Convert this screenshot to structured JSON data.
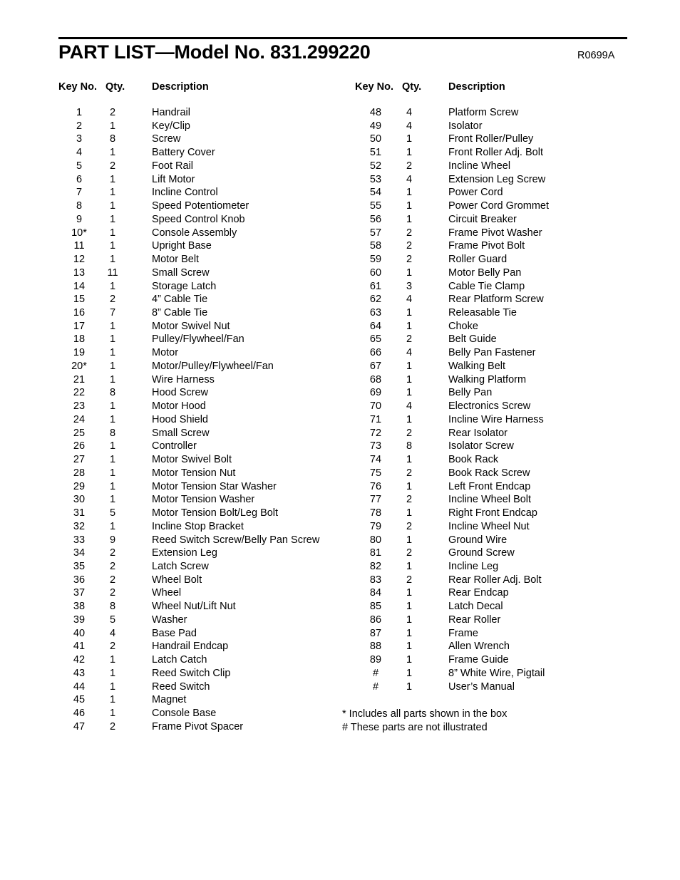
{
  "header": {
    "title": "PART LIST—Model No. 831.299220",
    "revision": "R0699A"
  },
  "columns": {
    "key_label": "Key No.",
    "qty_label": "Qty.",
    "description_label": "Description"
  },
  "footnotes": [
    "* Includes all parts shown in the box",
    "# These parts are not illustrated"
  ],
  "parts_left": [
    {
      "key": "1",
      "qty": "2",
      "description": "Handrail"
    },
    {
      "key": "2",
      "qty": "1",
      "description": "Key/Clip"
    },
    {
      "key": "3",
      "qty": "8",
      "description": "Screw"
    },
    {
      "key": "4",
      "qty": "1",
      "description": "Battery Cover"
    },
    {
      "key": "5",
      "qty": "2",
      "description": "Foot Rail"
    },
    {
      "key": "6",
      "qty": "1",
      "description": "Lift Motor"
    },
    {
      "key": "7",
      "qty": "1",
      "description": "Incline Control"
    },
    {
      "key": "8",
      "qty": "1",
      "description": "Speed Potentiometer"
    },
    {
      "key": "9",
      "qty": "1",
      "description": "Speed Control Knob"
    },
    {
      "key": "10*",
      "qty": "1",
      "description": "Console Assembly"
    },
    {
      "key": "11",
      "qty": "1",
      "description": "Upright Base"
    },
    {
      "key": "12",
      "qty": "1",
      "description": "Motor Belt"
    },
    {
      "key": "13",
      "qty": "11",
      "description": "Small Screw"
    },
    {
      "key": "14",
      "qty": "1",
      "description": "Storage Latch"
    },
    {
      "key": "15",
      "qty": "2",
      "description": "4” Cable Tie"
    },
    {
      "key": "16",
      "qty": "7",
      "description": "8” Cable Tie"
    },
    {
      "key": "17",
      "qty": "1",
      "description": "Motor Swivel Nut"
    },
    {
      "key": "18",
      "qty": "1",
      "description": "Pulley/Flywheel/Fan"
    },
    {
      "key": "19",
      "qty": "1",
      "description": "Motor"
    },
    {
      "key": "20*",
      "qty": "1",
      "description": "Motor/Pulley/Flywheel/Fan"
    },
    {
      "key": "21",
      "qty": "1",
      "description": "Wire Harness"
    },
    {
      "key": "22",
      "qty": "8",
      "description": "Hood Screw"
    },
    {
      "key": "23",
      "qty": "1",
      "description": "Motor Hood"
    },
    {
      "key": "24",
      "qty": "1",
      "description": "Hood Shield"
    },
    {
      "key": "25",
      "qty": "8",
      "description": "Small Screw"
    },
    {
      "key": "26",
      "qty": "1",
      "description": "Controller"
    },
    {
      "key": "27",
      "qty": "1",
      "description": "Motor Swivel Bolt"
    },
    {
      "key": "28",
      "qty": "1",
      "description": "Motor Tension Nut"
    },
    {
      "key": "29",
      "qty": "1",
      "description": "Motor Tension Star Washer"
    },
    {
      "key": "30",
      "qty": "1",
      "description": "Motor Tension Washer"
    },
    {
      "key": "31",
      "qty": "5",
      "description": "Motor Tension Bolt/Leg Bolt"
    },
    {
      "key": "32",
      "qty": "1",
      "description": "Incline Stop Bracket"
    },
    {
      "key": "33",
      "qty": "9",
      "description": "Reed Switch Screw/Belly Pan Screw"
    },
    {
      "key": "34",
      "qty": "2",
      "description": "Extension Leg"
    },
    {
      "key": "35",
      "qty": "2",
      "description": "Latch Screw"
    },
    {
      "key": "36",
      "qty": "2",
      "description": "Wheel Bolt"
    },
    {
      "key": "37",
      "qty": "2",
      "description": "Wheel"
    },
    {
      "key": "38",
      "qty": "8",
      "description": "Wheel Nut/Lift Nut"
    },
    {
      "key": "39",
      "qty": "5",
      "description": "Washer"
    },
    {
      "key": "40",
      "qty": "4",
      "description": "Base Pad"
    },
    {
      "key": "41",
      "qty": "2",
      "description": "Handrail Endcap"
    },
    {
      "key": "42",
      "qty": "1",
      "description": "Latch Catch"
    },
    {
      "key": "43",
      "qty": "1",
      "description": "Reed Switch Clip"
    },
    {
      "key": "44",
      "qty": "1",
      "description": "Reed Switch"
    },
    {
      "key": "45",
      "qty": "1",
      "description": "Magnet"
    },
    {
      "key": "46",
      "qty": "1",
      "description": "Console Base"
    },
    {
      "key": "47",
      "qty": "2",
      "description": "Frame Pivot Spacer"
    }
  ],
  "parts_right": [
    {
      "key": "48",
      "qty": "4",
      "description": "Platform Screw"
    },
    {
      "key": "49",
      "qty": "4",
      "description": "Isolator"
    },
    {
      "key": "50",
      "qty": "1",
      "description": "Front Roller/Pulley"
    },
    {
      "key": "51",
      "qty": "1",
      "description": "Front Roller Adj. Bolt"
    },
    {
      "key": "52",
      "qty": "2",
      "description": "Incline Wheel"
    },
    {
      "key": "53",
      "qty": "4",
      "description": "Extension Leg Screw"
    },
    {
      "key": "54",
      "qty": "1",
      "description": "Power Cord"
    },
    {
      "key": "55",
      "qty": "1",
      "description": "Power Cord Grommet"
    },
    {
      "key": "56",
      "qty": "1",
      "description": "Circuit Breaker"
    },
    {
      "key": "57",
      "qty": "2",
      "description": "Frame Pivot Washer"
    },
    {
      "key": "58",
      "qty": "2",
      "description": "Frame Pivot Bolt"
    },
    {
      "key": "59",
      "qty": "2",
      "description": "Roller Guard"
    },
    {
      "key": "60",
      "qty": "1",
      "description": "Motor Belly Pan"
    },
    {
      "key": "61",
      "qty": "3",
      "description": "Cable Tie Clamp"
    },
    {
      "key": "62",
      "qty": "4",
      "description": "Rear Platform Screw"
    },
    {
      "key": "63",
      "qty": "1",
      "description": "Releasable Tie"
    },
    {
      "key": "64",
      "qty": "1",
      "description": "Choke"
    },
    {
      "key": "65",
      "qty": "2",
      "description": "Belt Guide"
    },
    {
      "key": "66",
      "qty": "4",
      "description": "Belly Pan Fastener"
    },
    {
      "key": "67",
      "qty": "1",
      "description": "Walking Belt"
    },
    {
      "key": "68",
      "qty": "1",
      "description": "Walking Platform"
    },
    {
      "key": "69",
      "qty": "1",
      "description": "Belly Pan"
    },
    {
      "key": "70",
      "qty": "4",
      "description": "Electronics Screw"
    },
    {
      "key": "71",
      "qty": "1",
      "description": "Incline Wire Harness"
    },
    {
      "key": "72",
      "qty": "2",
      "description": "Rear Isolator"
    },
    {
      "key": "73",
      "qty": "8",
      "description": "Isolator Screw"
    },
    {
      "key": "74",
      "qty": "1",
      "description": "Book Rack"
    },
    {
      "key": "75",
      "qty": "2",
      "description": "Book Rack Screw"
    },
    {
      "key": "76",
      "qty": "1",
      "description": "Left Front Endcap"
    },
    {
      "key": "77",
      "qty": "2",
      "description": "Incline Wheel Bolt"
    },
    {
      "key": "78",
      "qty": "1",
      "description": "Right Front Endcap"
    },
    {
      "key": "79",
      "qty": "2",
      "description": "Incline Wheel Nut"
    },
    {
      "key": "80",
      "qty": "1",
      "description": "Ground Wire"
    },
    {
      "key": "81",
      "qty": "2",
      "description": "Ground Screw"
    },
    {
      "key": "82",
      "qty": "1",
      "description": "Incline Leg"
    },
    {
      "key": "83",
      "qty": "2",
      "description": "Rear Roller Adj. Bolt"
    },
    {
      "key": "84",
      "qty": "1",
      "description": "Rear Endcap"
    },
    {
      "key": "85",
      "qty": "1",
      "description": "Latch Decal"
    },
    {
      "key": "86",
      "qty": "1",
      "description": "Rear Roller"
    },
    {
      "key": "87",
      "qty": "1",
      "description": "Frame"
    },
    {
      "key": "88",
      "qty": "1",
      "description": "Allen Wrench"
    },
    {
      "key": "89",
      "qty": "1",
      "description": "Frame Guide"
    },
    {
      "key": "#",
      "qty": "1",
      "description": "8” White Wire, Pigtail"
    },
    {
      "key": "#",
      "qty": "1",
      "description": "User’s Manual"
    }
  ]
}
